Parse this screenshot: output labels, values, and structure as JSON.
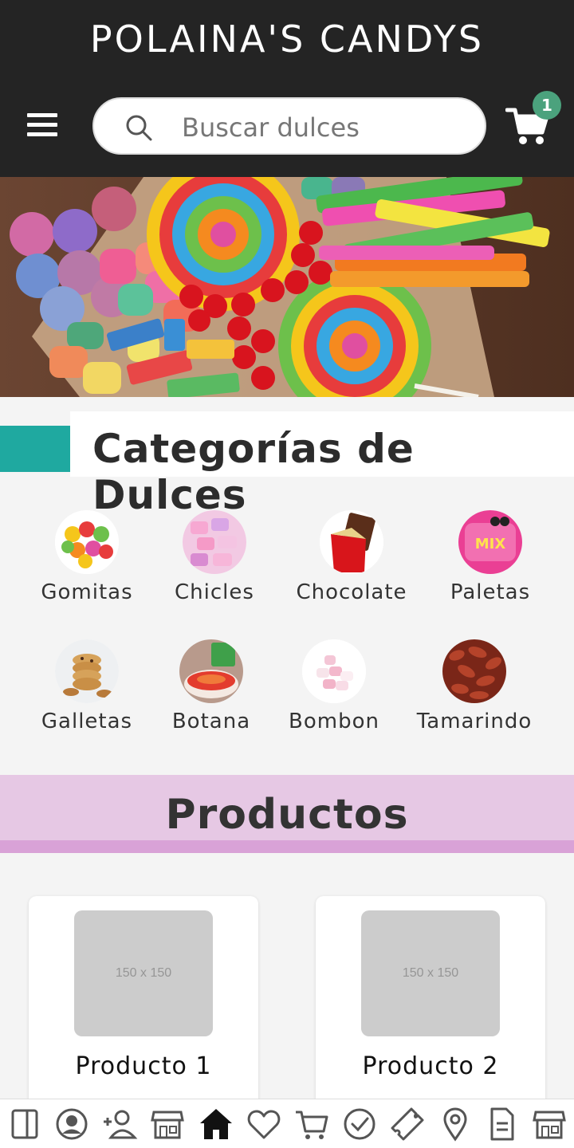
{
  "header": {
    "brand": "POLAINA'S CANDYS",
    "search_placeholder": "Buscar dulces",
    "cart_count": "1",
    "icons": [
      "menu-icon",
      "search-icon",
      "cart-icon"
    ]
  },
  "categories_section": {
    "title": "Categorías de Dulces",
    "items": [
      {
        "label": "Gomitas"
      },
      {
        "label": "Chicles"
      },
      {
        "label": "Chocolate"
      },
      {
        "label": "Paletas"
      },
      {
        "label": "Galletas"
      },
      {
        "label": "Botana"
      },
      {
        "label": "Bombon"
      },
      {
        "label": "Tamarindo"
      }
    ]
  },
  "products_section": {
    "title": "Productos",
    "items": [
      {
        "name": "Producto 1",
        "image_text": "150 x 150"
      },
      {
        "name": "Producto 2",
        "image_text": "150 x 150"
      }
    ]
  },
  "bottom_nav": {
    "icons": [
      "sidebar-icon",
      "account-icon",
      "add-user-icon",
      "store-icon",
      "home-icon",
      "heart-icon",
      "cart-icon",
      "check-icon",
      "ticket-icon",
      "location-icon",
      "document-icon",
      "shop-icon"
    ]
  },
  "colors": {
    "header_bg": "#242424",
    "accent_teal": "#1fa9a0",
    "products_band": "#e6c8e4",
    "products_bar": "#d9a2d7",
    "badge": "#4ba27d"
  }
}
